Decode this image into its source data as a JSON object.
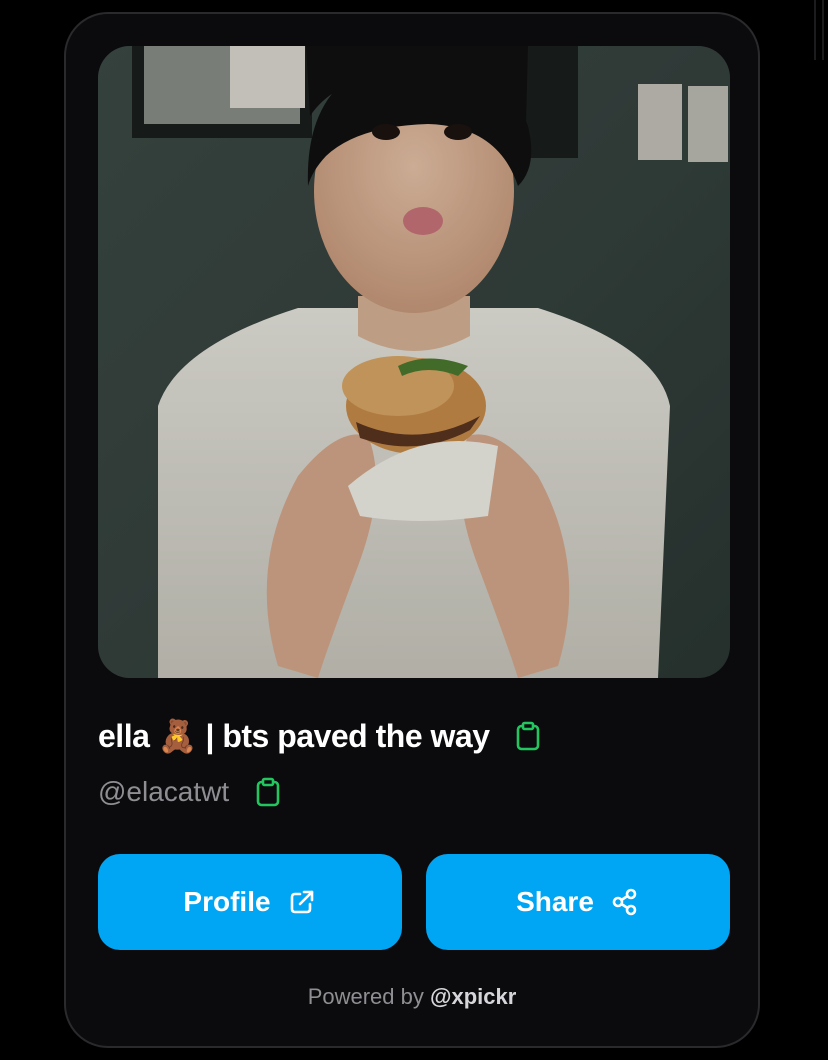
{
  "profile": {
    "display_name": "ella 🧸 | bts paved the way",
    "handle": "@elacatwt",
    "photo_description": "profile photo of a person in a white t-shirt eating a burger"
  },
  "buttons": {
    "profile_label": "Profile",
    "share_label": "Share"
  },
  "footer": {
    "prefix": "Powered by",
    "brand": "@xpickr"
  },
  "icons": {
    "copy_name": "clipboard-icon",
    "copy_handle": "clipboard-icon",
    "profile_button": "external-link-icon",
    "share_button": "share-icon"
  },
  "colors": {
    "background": "#000000",
    "card": "#0b0b0d",
    "card_border": "#2a2a2d",
    "button": "#00a6f4",
    "copy_icon": "#22c55e",
    "handle_text": "#8e8e93"
  }
}
